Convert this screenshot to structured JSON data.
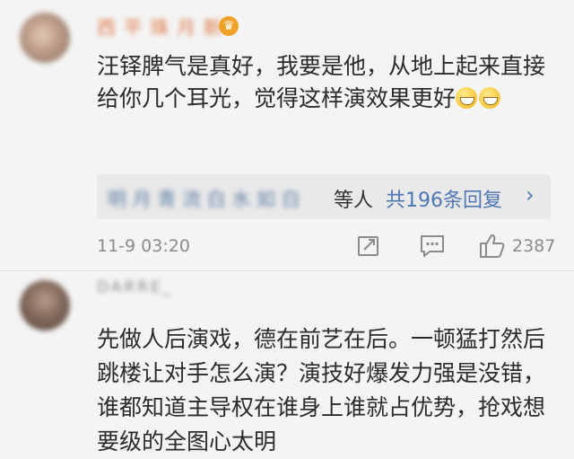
{
  "comments": [
    {
      "username": "西 平 珠 月 新",
      "text": "汪铎脾气是真好，我要是他，从地上起来直接给你几个耳光，觉得这样演效果更好",
      "replies": {
        "names": "明 月 青 流 白 水 如 白",
        "etc": "等人",
        "count": "共196条回复",
        "chevron": "›"
      },
      "time": "11-9 03:20",
      "likes": "2387"
    },
    {
      "username": "DARRE_",
      "text": "先做人后演戏，德在前艺在后。一顿猛打然后跳楼让对手怎么演？演技好爆发力强是没错，谁都知道主导权在谁身上谁就占优势，抢戏想要级的全图心太明"
    }
  ],
  "icons": {
    "vip": "crown-badge-icon",
    "share": "share-icon",
    "reply": "comment-icon",
    "like": "thumbs-up-icon"
  },
  "colors": {
    "background": "#f4f4f4",
    "link": "#4f77b4",
    "username": "#e07a4a",
    "muted": "#8b8b8b"
  }
}
